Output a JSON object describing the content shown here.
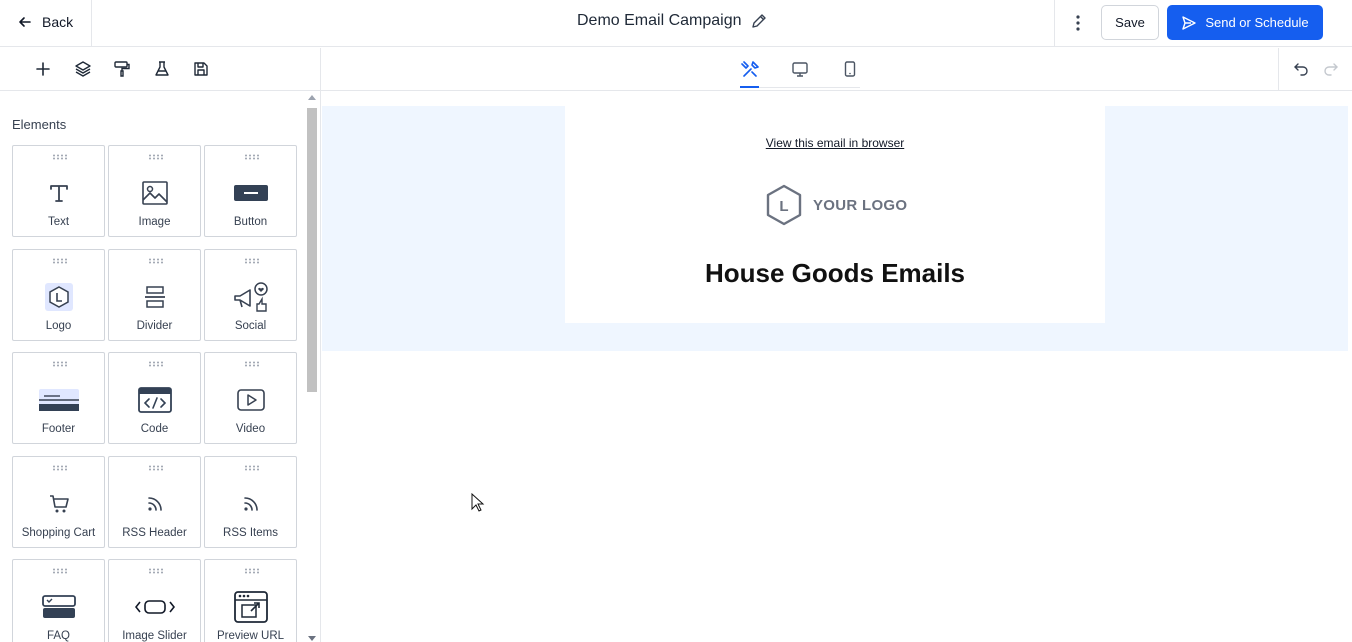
{
  "header": {
    "back_label": "Back",
    "campaign_title": "Demo Email Campaign",
    "save_label": "Save",
    "send_label": "Send or Schedule",
    "accent_color": "#155eef"
  },
  "toolbar": {
    "tools": [
      "add-icon",
      "layers-icon",
      "paint-roller-icon",
      "flask-icon",
      "floppy-disk-icon"
    ],
    "view_tabs": [
      "tools-icon",
      "desktop-icon",
      "mobile-icon"
    ],
    "active_view": "tools-icon"
  },
  "sidebar": {
    "heading": "Elements",
    "elements": [
      {
        "label": "Text",
        "icon": "text-icon"
      },
      {
        "label": "Image",
        "icon": "image-icon"
      },
      {
        "label": "Button",
        "icon": "button-icon"
      },
      {
        "label": "Logo",
        "icon": "logo-icon"
      },
      {
        "label": "Divider",
        "icon": "divider-icon"
      },
      {
        "label": "Social",
        "icon": "social-icon"
      },
      {
        "label": "Footer",
        "icon": "footer-icon"
      },
      {
        "label": "Code",
        "icon": "code-icon"
      },
      {
        "label": "Video",
        "icon": "video-icon"
      },
      {
        "label": "Shopping Cart",
        "icon": "shopping-cart-icon"
      },
      {
        "label": "RSS Header",
        "icon": "rss-icon"
      },
      {
        "label": "RSS Items",
        "icon": "rss-icon"
      },
      {
        "label": "FAQ",
        "icon": "faq-icon"
      },
      {
        "label": "Image Slider",
        "icon": "image-slider-icon"
      },
      {
        "label": "Preview URL",
        "icon": "preview-url-icon"
      }
    ]
  },
  "email": {
    "view_in_browser": "View this email in browser",
    "logo_letter": "L",
    "logo_text": "YOUR LOGO",
    "heading": "House Goods Emails",
    "band_color": "#eff6ff"
  }
}
